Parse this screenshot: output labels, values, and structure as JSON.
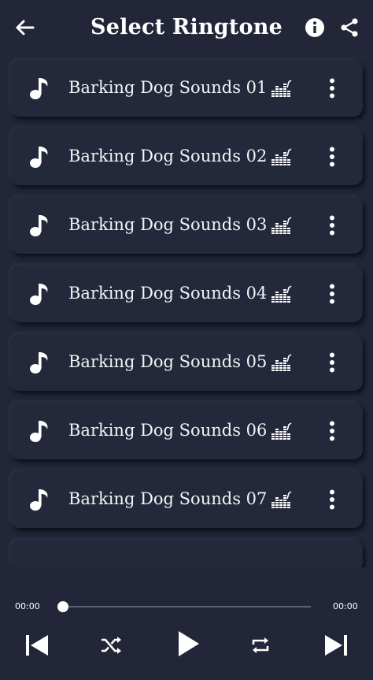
{
  "header": {
    "title": "Select Ringtone",
    "back_icon": "arrow-left-icon",
    "info_icon": "info-icon",
    "share_icon": "share-icon"
  },
  "ringtones": [
    {
      "label": "Barking Dog Sounds 01"
    },
    {
      "label": "Barking Dog Sounds 02"
    },
    {
      "label": "Barking Dog Sounds 03"
    },
    {
      "label": "Barking Dog Sounds 04"
    },
    {
      "label": "Barking Dog Sounds 05"
    },
    {
      "label": "Barking Dog Sounds 06"
    },
    {
      "label": "Barking Dog Sounds 07"
    }
  ],
  "player": {
    "current_time": "00:00",
    "total_time": "00:00",
    "progress": 0
  },
  "colors": {
    "background": "#222638",
    "text": "#ffffff",
    "track": "#5b6072"
  }
}
